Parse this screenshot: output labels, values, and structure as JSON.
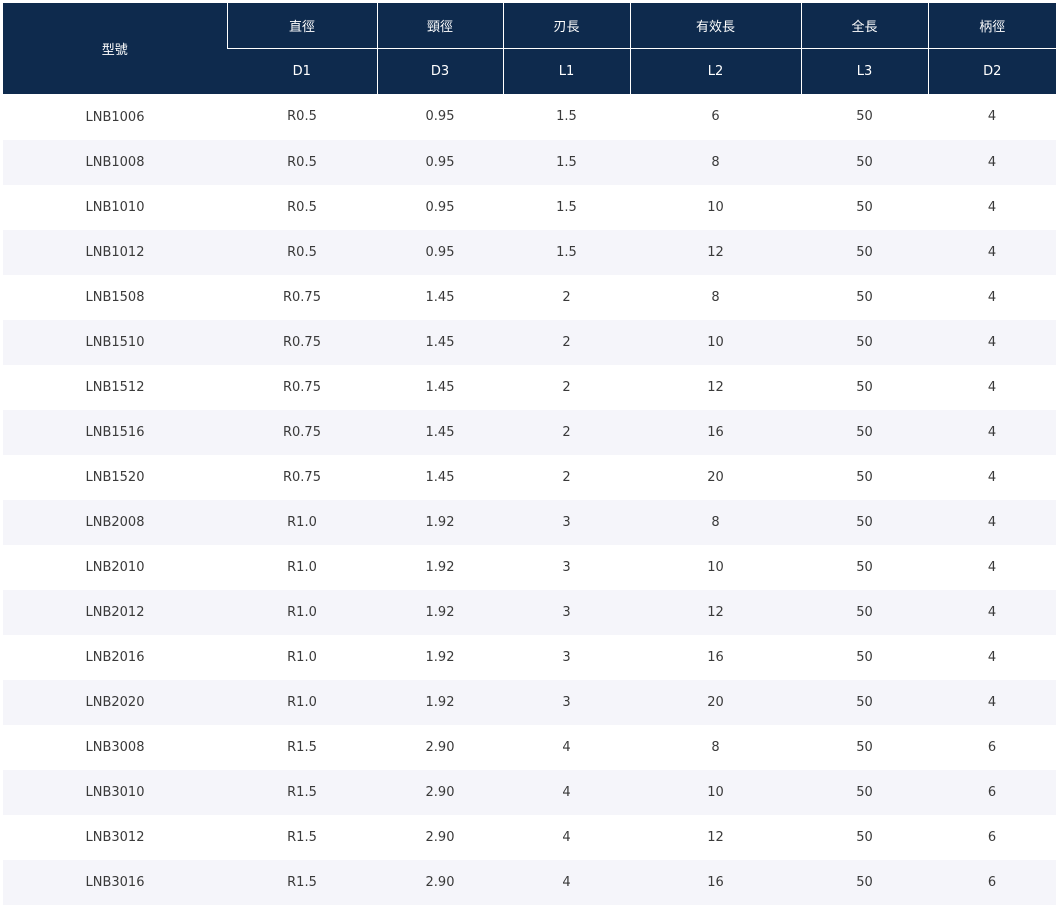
{
  "table": {
    "header_top": {
      "model": "型號",
      "diameter": "直徑",
      "neck_diameter": "頸徑",
      "flute_length": "刃長",
      "effective_length": "有效長",
      "overall_length": "全長",
      "shank_diameter": "柄徑"
    },
    "header_codes": {
      "diameter": "D1",
      "neck_diameter": "D3",
      "flute_length": "L1",
      "effective_length": "L2",
      "overall_length": "L3",
      "shank_diameter": "D2"
    },
    "colors": {
      "header_bg": "#0e2a4d",
      "stripe_bg": "#f5f5fa"
    },
    "rows": [
      [
        "LNB1006",
        "R0.5",
        "0.95",
        "1.5",
        "6",
        "50",
        "4"
      ],
      [
        "LNB1008",
        "R0.5",
        "0.95",
        "1.5",
        "8",
        "50",
        "4"
      ],
      [
        "LNB1010",
        "R0.5",
        "0.95",
        "1.5",
        "10",
        "50",
        "4"
      ],
      [
        "LNB1012",
        "R0.5",
        "0.95",
        "1.5",
        "12",
        "50",
        "4"
      ],
      [
        "LNB1508",
        "R0.75",
        "1.45",
        "2",
        "8",
        "50",
        "4"
      ],
      [
        "LNB1510",
        "R0.75",
        "1.45",
        "2",
        "10",
        "50",
        "4"
      ],
      [
        "LNB1512",
        "R0.75",
        "1.45",
        "2",
        "12",
        "50",
        "4"
      ],
      [
        "LNB1516",
        "R0.75",
        "1.45",
        "2",
        "16",
        "50",
        "4"
      ],
      [
        "LNB1520",
        "R0.75",
        "1.45",
        "2",
        "20",
        "50",
        "4"
      ],
      [
        "LNB2008",
        "R1.0",
        "1.92",
        "3",
        "8",
        "50",
        "4"
      ],
      [
        "LNB2010",
        "R1.0",
        "1.92",
        "3",
        "10",
        "50",
        "4"
      ],
      [
        "LNB2012",
        "R1.0",
        "1.92",
        "3",
        "12",
        "50",
        "4"
      ],
      [
        "LNB2016",
        "R1.0",
        "1.92",
        "3",
        "16",
        "50",
        "4"
      ],
      [
        "LNB2020",
        "R1.0",
        "1.92",
        "3",
        "20",
        "50",
        "4"
      ],
      [
        "LNB3008",
        "R1.5",
        "2.90",
        "4",
        "8",
        "50",
        "6"
      ],
      [
        "LNB3010",
        "R1.5",
        "2.90",
        "4",
        "10",
        "50",
        "6"
      ],
      [
        "LNB3012",
        "R1.5",
        "2.90",
        "4",
        "12",
        "50",
        "6"
      ],
      [
        "LNB3016",
        "R1.5",
        "2.90",
        "4",
        "16",
        "50",
        "6"
      ]
    ]
  }
}
